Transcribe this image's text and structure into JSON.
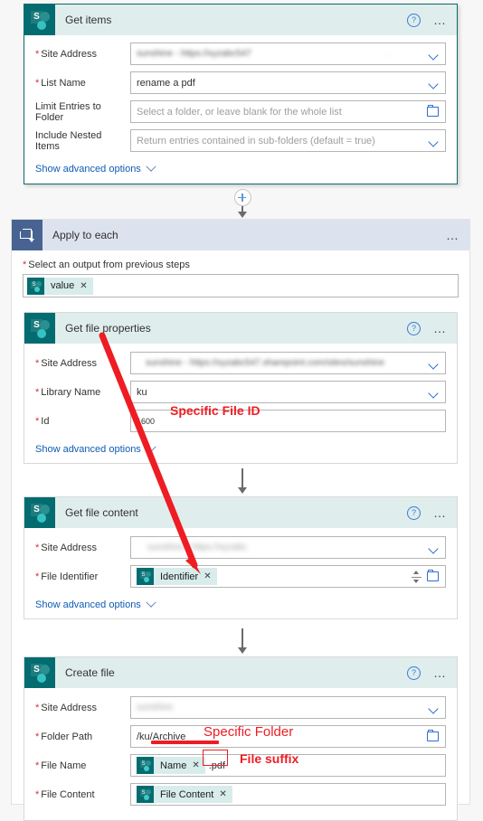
{
  "flow": {
    "steps": [
      {
        "id": "get-items",
        "title": "Get items",
        "icon": "sharepoint-icon",
        "help_icon": "help-icon",
        "menu_icon": "more-options-icon",
        "fields": [
          {
            "label": "Site Address",
            "required": true,
            "value": "",
            "placeholder": "",
            "control": "dropdown",
            "redacted": true
          },
          {
            "label": "List Name",
            "required": true,
            "value": "rename a pdf",
            "placeholder": "",
            "control": "dropdown"
          },
          {
            "label": "Limit Entries to Folder",
            "required": false,
            "value": "",
            "placeholder": "Select a folder, or leave blank for the whole list",
            "control": "folder-picker"
          },
          {
            "label": "Include Nested Items",
            "required": false,
            "value": "",
            "placeholder": "Return entries contained in sub-folders (default = true)",
            "control": "dropdown"
          }
        ],
        "advanced_label": "Show advanced options"
      },
      {
        "id": "apply-to-each",
        "title": "Apply to each",
        "icon": "loop-icon",
        "menu_icon": "more-options-icon",
        "output_label": "Select an output from previous steps",
        "output_required": true,
        "output_token": "value",
        "token_remove_label": "×"
      },
      {
        "id": "get-file-properties",
        "title": "Get file properties",
        "icon": "sharepoint-icon",
        "help_icon": "help-icon",
        "menu_icon": "more-options-icon",
        "fields": [
          {
            "label": "Site Address",
            "required": true,
            "value": "",
            "placeholder": "",
            "control": "dropdown",
            "redacted": true
          },
          {
            "label": "Library Name",
            "required": true,
            "value": "ku",
            "placeholder": "",
            "control": "dropdown"
          },
          {
            "label": "Id",
            "required": true,
            "value": "1600",
            "placeholder": "",
            "control": "text"
          }
        ],
        "advanced_label": "Show advanced options"
      },
      {
        "id": "get-file-content",
        "title": "Get file content",
        "icon": "sharepoint-icon",
        "help_icon": "help-icon",
        "menu_icon": "more-options-icon",
        "fields": [
          {
            "label": "Site Address",
            "required": true,
            "value": "",
            "placeholder": "",
            "control": "dropdown",
            "redacted": true
          },
          {
            "label": "File Identifier",
            "required": true,
            "token": "Identifier",
            "control": "token-picker"
          }
        ],
        "advanced_label": "Show advanced options"
      },
      {
        "id": "create-file",
        "title": "Create file",
        "icon": "sharepoint-icon",
        "help_icon": "help-icon",
        "menu_icon": "more-options-icon",
        "fields": [
          {
            "label": "Site Address",
            "required": true,
            "value": "",
            "placeholder": "",
            "control": "dropdown",
            "redacted": true
          },
          {
            "label": "Folder Path",
            "required": true,
            "value": "/ku/Archive",
            "placeholder": "",
            "control": "folder-picker"
          },
          {
            "label": "File Name",
            "required": true,
            "token": "Name",
            "suffix": ".pdf",
            "control": "token-text"
          },
          {
            "label": "File Content",
            "required": true,
            "token": "File Content",
            "control": "token-picker"
          }
        ]
      }
    ],
    "add_step_label": "+"
  },
  "annotations": [
    {
      "id": "specific-file-id",
      "text": "Specific File ID"
    },
    {
      "id": "specific-folder",
      "text": "Specific Folder"
    },
    {
      "id": "file-suffix",
      "text": "File suffix"
    }
  ],
  "colors": {
    "sharepoint_teal": "#036c70",
    "loop_blue": "#486392",
    "annotation_red": "#ee1d23",
    "link_blue": "#0f5bb5",
    "required_red": "#d13438"
  }
}
